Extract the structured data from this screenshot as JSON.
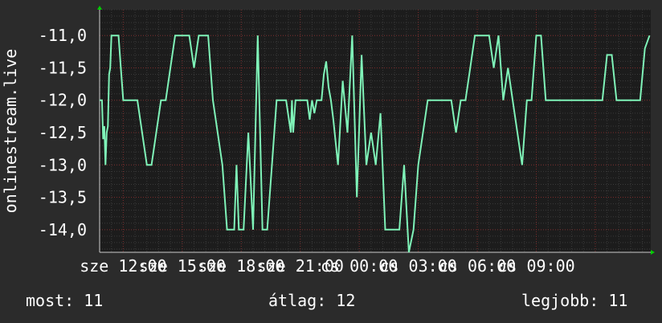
{
  "chart_data": {
    "type": "line",
    "ylabel": "onlinestream.live",
    "ylim": [
      -14.35,
      -10.6
    ],
    "yticks": [
      -11.0,
      -11.5,
      -12.0,
      -12.5,
      -13.0,
      -13.5,
      -14.0
    ],
    "ytick_labels": [
      "-11,0",
      "-11,5",
      "-12,0",
      "-12,5",
      "-13,0",
      "-13,5",
      "-14,0"
    ],
    "xlim": [
      0,
      23.35
    ],
    "xticks": [
      1.0,
      3.5,
      6.0,
      8.5,
      11.0,
      13.5,
      16.0,
      18.5,
      21.0
    ],
    "xtick_labels": [
      "sze 12:00",
      "sze 15:00",
      "sze 18:00",
      "sze 21:00",
      "cs 00:00",
      "cs 03:00",
      "cs 06:00",
      "cs 09:00",
      ""
    ],
    "grid": true,
    "color": "#7ff3b8",
    "x": [
      0,
      0.1,
      0.15,
      0.2,
      0.25,
      0.3,
      0.35,
      0.4,
      0.45,
      0.5,
      0.55,
      0.6,
      0.65,
      0.75,
      0.8,
      0.9,
      1.0,
      1.1,
      1.2,
      1.3,
      1.4,
      1.6,
      1.8,
      2.0,
      2.2,
      2.4,
      2.6,
      2.7,
      2.8,
      3.0,
      3.2,
      3.4,
      3.6,
      3.8,
      4.0,
      4.2,
      4.4,
      4.6,
      4.8,
      5.0,
      5.2,
      5.4,
      5.5,
      5.6,
      5.7,
      5.8,
      5.9,
      6.0,
      6.1,
      6.3,
      6.5,
      6.7,
      6.9,
      7.1,
      7.3,
      7.5,
      7.7,
      7.9,
      8.1,
      8.15,
      8.2,
      8.3,
      8.5,
      8.7,
      8.8,
      8.9,
      9.0,
      9.1,
      9.2,
      9.3,
      9.4,
      9.5,
      9.6,
      9.7,
      9.8,
      9.9,
      10.1,
      10.3,
      10.5,
      10.7,
      10.9,
      11.1,
      11.3,
      11.5,
      11.7,
      11.9,
      12.1,
      12.3,
      12.5,
      12.7,
      12.9,
      13.1,
      13.3,
      13.5,
      13.7,
      13.9,
      14.1,
      14.3,
      14.5,
      14.7,
      14.9,
      15.1,
      15.3,
      15.5,
      15.7,
      15.9,
      16.1,
      16.3,
      16.5,
      16.7,
      16.9,
      17.1,
      17.3,
      17.5,
      17.7,
      17.9,
      18.1,
      18.3,
      18.5,
      18.7,
      18.9,
      19.1,
      19.3,
      19.5,
      19.7,
      19.9,
      20.1,
      20.3,
      20.5,
      20.7,
      20.9,
      21.1,
      21.3,
      21.5,
      21.7,
      21.9,
      22.1,
      22.3,
      22.5,
      22.7,
      22.9,
      23.1,
      23.3
    ],
    "values": [
      -12.0,
      -12.0,
      -12.6,
      -12.4,
      -13.0,
      -12.5,
      -12.4,
      -11.6,
      -11.5,
      -11.0,
      -11.0,
      -11.0,
      -11.0,
      -11.0,
      -11.0,
      -11.5,
      -12.0,
      -12.0,
      -12.0,
      -12.0,
      -12.0,
      -12.0,
      -12.5,
      -13.0,
      -13.0,
      -12.5,
      -12.0,
      -12.0,
      -12.0,
      -11.5,
      -11.0,
      -11.0,
      -11.0,
      -11.0,
      -11.5,
      -11.0,
      -11.0,
      -11.0,
      -12.0,
      -12.5,
      -13.0,
      -14.0,
      -14.0,
      -14.0,
      -14.0,
      -13.0,
      -14.0,
      -14.0,
      -14.0,
      -12.5,
      -14.0,
      -11.0,
      -14.0,
      -14.0,
      -13.0,
      -12.0,
      -12.0,
      -12.0,
      -12.5,
      -12.0,
      -12.5,
      -12.0,
      -12.0,
      -12.0,
      -12.0,
      -12.3,
      -12.0,
      -12.2,
      -12.0,
      -12.0,
      -12.0,
      -11.6,
      -11.4,
      -11.8,
      -12.0,
      -12.3,
      -13.0,
      -11.7,
      -12.5,
      -11.0,
      -13.5,
      -11.3,
      -13.0,
      -12.5,
      -13.0,
      -12.2,
      -14.0,
      -14.0,
      -14.0,
      -14.0,
      -13.0,
      -14.35,
      -14.0,
      -13.0,
      -12.5,
      -12.0,
      -12.0,
      -12.0,
      -12.0,
      -12.0,
      -12.0,
      -12.5,
      -12.0,
      -12.0,
      -11.5,
      -11.0,
      -11.0,
      -11.0,
      -11.0,
      -11.5,
      -11.0,
      -12.0,
      -11.5,
      -12.0,
      -12.5,
      -13.0,
      -12.0,
      -12.0,
      -11.0,
      -11.0,
      -12.0,
      -12.0,
      -12.0,
      -12.0,
      -12.0,
      -12.0,
      -12.0,
      -12.0,
      -12.0,
      -12.0,
      -12.0,
      -12.0,
      -12.0,
      -11.3,
      -11.3,
      -12.0,
      -12.0,
      -12.0,
      -12.0,
      -12.0,
      -12.0,
      -11.2,
      -11.0
    ]
  },
  "stats": {
    "now": "most: 11",
    "avg": "átlag: 12",
    "best": "legjobb: 11"
  }
}
